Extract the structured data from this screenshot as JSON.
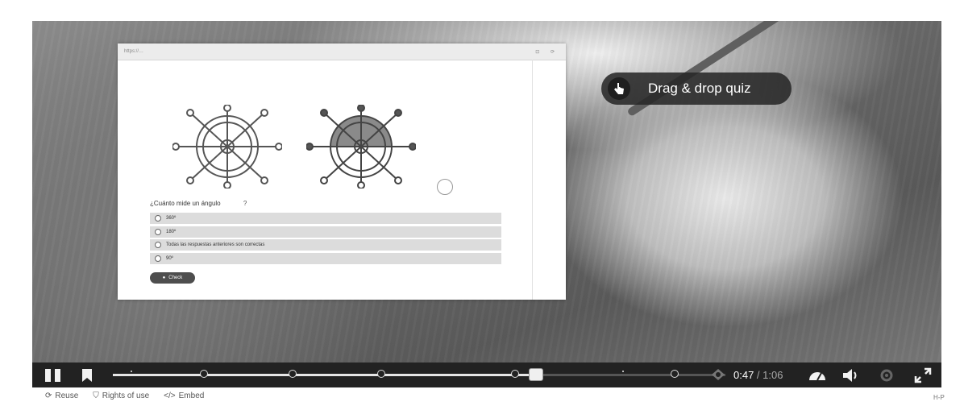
{
  "embedded_quiz": {
    "url": "https://…",
    "question": "¿Cuánto mide un ángulo",
    "help_icon": "question-icon",
    "options": [
      "360º",
      "180º",
      "Todas las respuestas anteriores son correctas",
      "90º"
    ],
    "check_label": "Check"
  },
  "overlay_pill": {
    "label": "Drag & drop quiz",
    "icon": "hand-pointer-icon"
  },
  "player": {
    "current_time": "0:47",
    "separator": " / ",
    "duration": "1:06",
    "progress_fraction": 0.69
  },
  "footer": {
    "reuse_label": "Reuse",
    "rights_label": "Rights of use",
    "embed_label": "Embed",
    "badge": "H-P"
  }
}
